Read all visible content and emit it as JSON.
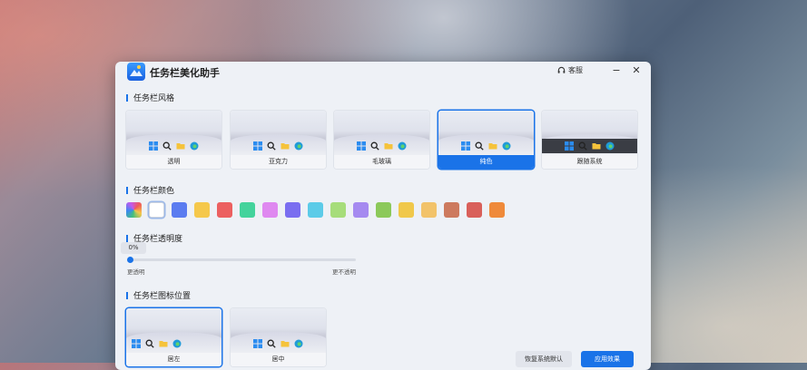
{
  "app": {
    "title": "任务栏美化助手",
    "feedback_label": "客服",
    "minimize_icon": "minimize-icon",
    "close_icon": "close-icon"
  },
  "style_section": {
    "title": "任务栏风格",
    "cards": [
      {
        "label": "透明",
        "selected": false
      },
      {
        "label": "亚克力",
        "selected": false
      },
      {
        "label": "毛玻璃",
        "selected": false
      },
      {
        "label": "纯色",
        "selected": true
      },
      {
        "label": "跟随系统",
        "selected": false
      }
    ]
  },
  "color_section": {
    "title": "任务栏颜色",
    "swatches": [
      "multicolor",
      "#ffffff",
      "#5b7cf0",
      "#f5c84b",
      "#ec6060",
      "#44d39c",
      "#df88f0",
      "#7a6ef0",
      "#5ccbe8",
      "#a6dd7a",
      "#a58af0",
      "#8cc95a",
      "#f0c84a",
      "#f2c36a",
      "#cd7a5e",
      "#d9605a",
      "#ef8a3a"
    ],
    "selected_index": 1
  },
  "opacity_section": {
    "title": "任务栏透明度",
    "value_label": "0%",
    "value": 0,
    "min_label": "更透明",
    "max_label": "更不透明"
  },
  "position_section": {
    "title": "任务栏图标位置",
    "cards": [
      {
        "label": "居左",
        "selected": true
      },
      {
        "label": "居中",
        "selected": false
      }
    ]
  },
  "actions": {
    "reset_label": "恢复系统默认",
    "apply_label": "应用效果"
  },
  "colors": {
    "accent": "#1a73e8"
  }
}
